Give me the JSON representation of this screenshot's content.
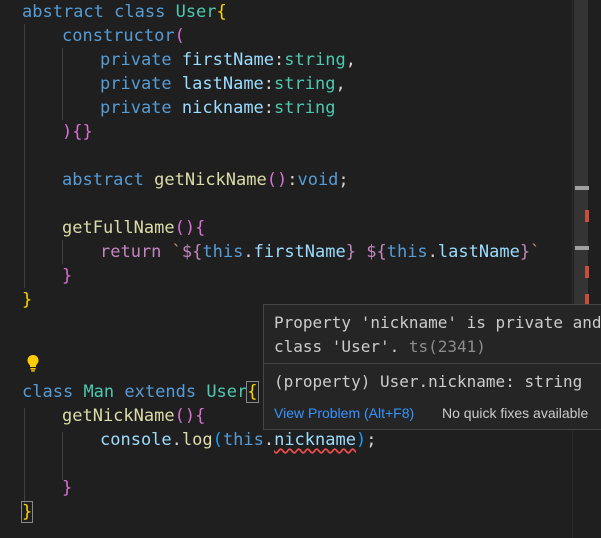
{
  "editor": {
    "lines": {
      "l1": {
        "kw1": "abstract",
        "kw2": "class",
        "cls": "User",
        "br": "{"
      },
      "l2": {
        "fn": "constructor",
        "br": "("
      },
      "l3": {
        "kw": "private",
        "prm": "firstName",
        "colon": ":",
        "type": "string",
        "comma": ","
      },
      "l4": {
        "kw": "private",
        "prm": "lastName",
        "colon": ":",
        "type": "string",
        "comma": ","
      },
      "l5": {
        "kw": "private",
        "prm": "nickname",
        "colon": ":",
        "type": "string"
      },
      "l6": {
        "b1": ")",
        "b2": "{}"
      },
      "l8": {
        "kw": "abstract",
        "fn": "getNickName",
        "parens": "()",
        "colon": ":",
        "type": "void",
        "semi": ";"
      },
      "l10": {
        "fn": "getFullName",
        "parens": "()",
        "br": "{"
      },
      "l11": {
        "kw": "return",
        "tick1": "`",
        "d1": "${",
        "this1": "this",
        "dot1": ".",
        "p1": "firstName",
        "c1": "}",
        "sp": " ",
        "d2": "${",
        "this2": "this",
        "dot2": ".",
        "p2": "lastName",
        "c2": "}",
        "tick2": "`"
      },
      "l12": {
        "br": "}"
      },
      "l13": {
        "br": "}"
      },
      "l16": {
        "kw1": "class",
        "cls1": "Man",
        "kw2": "extends",
        "cls2": "User",
        "br": "{"
      },
      "l17": {
        "fn": "getNickName",
        "parens": "()",
        "br": "{"
      },
      "l18": {
        "obj": "console",
        "dot": ".",
        "fn": "log",
        "open": "(",
        "kw": "this",
        "dot2": ".",
        "prm": "nickname",
        "close": ")",
        "semi": ";"
      },
      "l20": {
        "br": "}"
      },
      "l21": {
        "br": "}"
      }
    }
  },
  "hover": {
    "message_line1": "Property 'nickname' is private and",
    "message_line2": "class 'User'.",
    "error_code": "ts(2341)",
    "signature": "(property) User.nickname: string",
    "view_problem": "View Problem (Alt+F8)",
    "no_fixes": "No quick fixes available"
  },
  "colors": {
    "background": "#1f1f1f",
    "keyword": "#569cd6",
    "control_keyword": "#c586c0",
    "class_name": "#4ec9b0",
    "function": "#dcdcaa",
    "property": "#9cdcfe",
    "string": "#ce9178",
    "error": "#f14c4c",
    "link": "#3794ff"
  },
  "icons": {
    "lightbulb": "lightbulb-icon"
  }
}
